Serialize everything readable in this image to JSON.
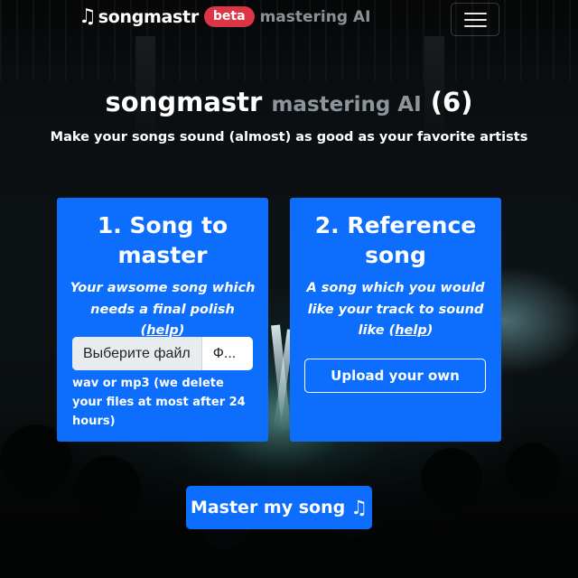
{
  "nav": {
    "brand_icon": "music-note-icon",
    "brand_name": "songmastr",
    "badge": "beta",
    "tagline": "mastering AI",
    "menu_icon": "hamburger-menu-icon"
  },
  "hero": {
    "title_main": "songmastr",
    "title_muted": "mastering AI",
    "title_count": "(6)",
    "subtitle": "Make your songs sound (almost) as good as your favorite artists"
  },
  "card1": {
    "title": "1. Song to master",
    "desc_text": "Your awsome song which needs a final polish (",
    "help_link": "help",
    "desc_end": ")",
    "file_button": "Выберите файл",
    "file_name": "Ф...",
    "hint": "wav or mp3 (we delete your files at most after 24 hours)"
  },
  "card2": {
    "title": "2. Reference song",
    "desc_text": "A song which you would like your track to sound like (",
    "help_link": "help",
    "desc_end": ")",
    "upload_button": "Upload your own"
  },
  "action": {
    "master_button": "Master my song",
    "master_icon": "music-note-icon"
  },
  "colors": {
    "primary": "#0d6efd",
    "badge": "#dc3545",
    "muted": "#8d959b",
    "background": "#07090b"
  }
}
